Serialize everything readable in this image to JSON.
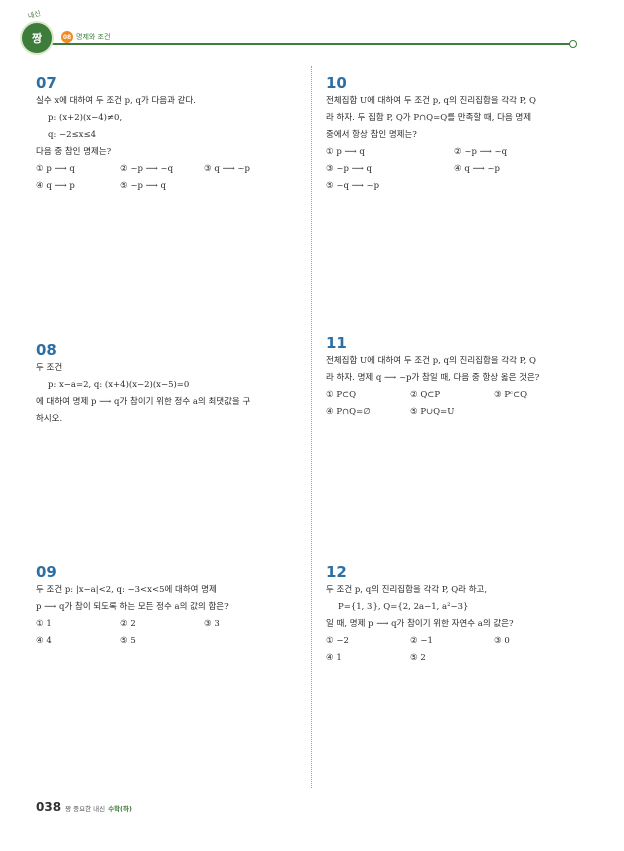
{
  "header": {
    "logo_text": "짱",
    "logo_arc": "내신",
    "chapter_number": "08",
    "chapter_title": "명제와 조건"
  },
  "problems": {
    "p07": {
      "number": "07",
      "lines": [
        "실수 x에 대하여 두 조건 p, q가 다음과 같다."
      ],
      "conditions": [
        "p: (x+2)(x−4)≠0,",
        "q: −2≤x≤4"
      ],
      "question": "다음 중 참인 명제는?",
      "choices": [
        "① p ⟶ q",
        "② ~p ⟶ ~q",
        "③ q ⟶ ~p",
        "④ q ⟶ p",
        "⑤ ~p ⟶ q"
      ]
    },
    "p08": {
      "number": "08",
      "lines": [
        "두 조건"
      ],
      "conditions": [
        "p: x−a=2, q: (x+4)(x−2)(x−5)=0"
      ],
      "question_lines": [
        "에 대하여 명제 p ⟶ q가 참이기 위한 정수 a의 최댓값을 구",
        "하시오."
      ]
    },
    "p09": {
      "number": "09",
      "lines": [
        "두 조건 p: |x−a|<2, q: −3<x<5에 대하여 명제",
        "p ⟶ q가 참이 되도록 하는 모든 정수 a의 값의 합은?"
      ],
      "choices": [
        "① 1",
        "② 2",
        "③ 3",
        "④ 4",
        "⑤ 5"
      ]
    },
    "p10": {
      "number": "10",
      "lines": [
        "전체집합 U에 대하여 두 조건 p, q의 진리집합을 각각 P, Q",
        "라 하자. 두 집합 P, Q가 P∩Q=Q를 만족할 때, 다음 명제",
        "중에서 항상 참인 명제는?"
      ],
      "choices": [
        "① p ⟶ q",
        "② ~p ⟶ ~q",
        "③ ~p ⟶ q",
        "④ q ⟶ ~p",
        "⑤ ~q ⟶ ~p"
      ]
    },
    "p11": {
      "number": "11",
      "lines": [
        "전체집합 U에 대하여 두 조건 p, q의 진리집합을 각각 P, Q",
        "라 하자. 명제 q ⟶ ~p가 참일 때, 다음 중 항상 옳은 것은?"
      ],
      "choices": [
        "① P⊂Q",
        "② Q⊂P",
        "③ Pᶜ⊂Q",
        "④ P∩Q=∅",
        "⑤ P∪Q=U"
      ]
    },
    "p12": {
      "number": "12",
      "lines": [
        "두 조건 p, q의 진리집합을 각각 P, Q라 하고,"
      ],
      "conditions": [
        "P={1, 3}, Q={2, 2a−1, a²−3}"
      ],
      "question": "일 때, 명제 p ⟶ q가 참이기 위한 자연수 a의 값은?",
      "choices": [
        "① −2",
        "② −1",
        "③ 0",
        "④ 1",
        "⑤ 2"
      ]
    }
  },
  "footer": {
    "page_number": "038",
    "book_title": "짱 중요한 내신",
    "book_subject": "수학(하)"
  }
}
